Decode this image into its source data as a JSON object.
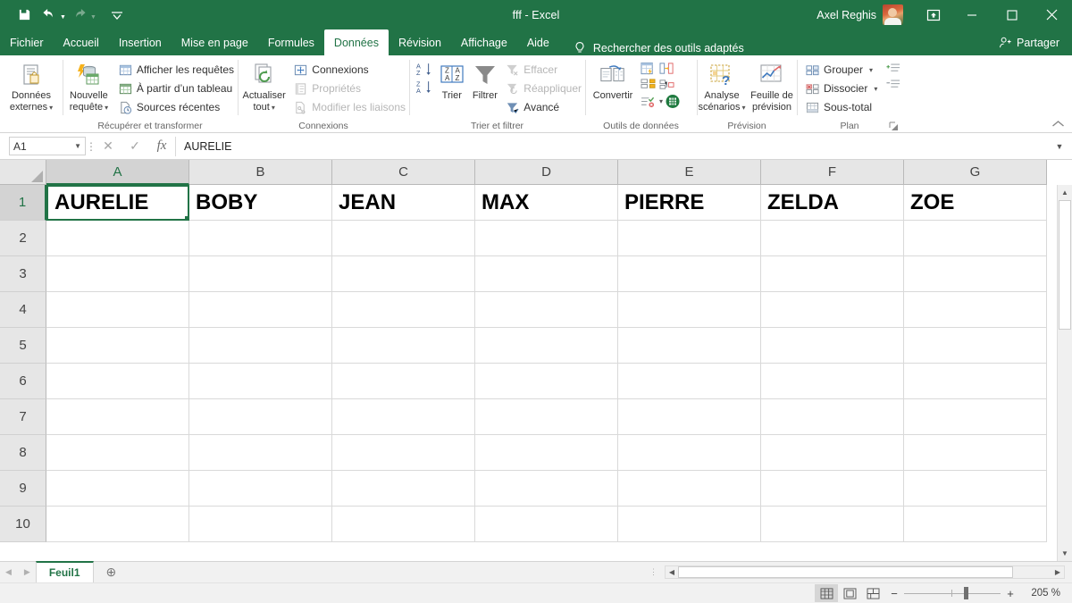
{
  "window": {
    "title": "fff  -  Excel",
    "account_name": "Axel Reghis",
    "quick_access": [
      {
        "name": "save",
        "icon": "save-icon"
      },
      {
        "name": "undo",
        "icon": "undo-icon"
      },
      {
        "name": "redo",
        "icon": "redo-icon"
      },
      {
        "name": "customize-quick-access-toolbar",
        "icon": "chevron-down-icon"
      }
    ],
    "buttons": {
      "ribbon_display_options": "ribbon-display-options-icon",
      "minimize": "minimize-icon",
      "maximize": "maximize-icon",
      "close": "close-icon"
    }
  },
  "tabs": [
    {
      "label": "Fichier",
      "active": false
    },
    {
      "label": "Accueil",
      "active": false
    },
    {
      "label": "Insertion",
      "active": false
    },
    {
      "label": "Mise en page",
      "active": false
    },
    {
      "label": "Formules",
      "active": false
    },
    {
      "label": "Données",
      "active": true
    },
    {
      "label": "Révision",
      "active": false
    },
    {
      "label": "Affichage",
      "active": false
    },
    {
      "label": "Aide",
      "active": false
    }
  ],
  "tellme": {
    "placeholder": "Rechercher des outils adaptés",
    "icon": "lightbulb-icon"
  },
  "share": {
    "label": "Partager",
    "icon": "share-person-icon"
  },
  "ribbon": {
    "groups": [
      {
        "label": "",
        "big_buttons": [
          {
            "label_line1": "Données",
            "label_line2": "externes",
            "has_caret": true,
            "icon": "external-data-icon"
          }
        ],
        "small_items": []
      },
      {
        "label": "Récupérer et transformer",
        "big_buttons": [
          {
            "label_line1": "Nouvelle",
            "label_line2": "requête",
            "has_caret": true,
            "icon": "new-query-icon"
          }
        ],
        "small_items": [
          {
            "label": "Afficher les requêtes",
            "icon": "show-queries-icon",
            "disabled": false
          },
          {
            "label": "À partir d’un tableau",
            "icon": "from-table-icon",
            "disabled": false
          },
          {
            "label": "Sources récentes",
            "icon": "recent-sources-icon",
            "disabled": false
          }
        ]
      },
      {
        "label": "Connexions",
        "big_buttons": [
          {
            "label_line1": "Actualiser",
            "label_line2": "tout",
            "has_caret": true,
            "icon": "refresh-all-icon"
          }
        ],
        "small_items": [
          {
            "label": "Connexions",
            "icon": "connections-icon",
            "disabled": false
          },
          {
            "label": "Propriétés",
            "icon": "properties-icon",
            "disabled": true
          },
          {
            "label": "Modifier les liaisons",
            "icon": "edit-links-icon",
            "disabled": true
          }
        ]
      },
      {
        "label": "Trier et filtrer",
        "big_buttons": [
          {
            "label_line1": "Trier",
            "label_line2": "",
            "has_caret": false,
            "icon": "sort-icon"
          },
          {
            "label_line1": "Filtrer",
            "label_line2": "",
            "has_caret": false,
            "icon": "filter-icon"
          }
        ],
        "mini_sort": [
          {
            "name": "sort-ascending-icon",
            "label": "A→Z"
          },
          {
            "name": "sort-descending-icon",
            "label": "Z→A"
          }
        ],
        "small_items": [
          {
            "label": "Effacer",
            "icon": "clear-filter-icon",
            "disabled": true
          },
          {
            "label": "Réappliquer",
            "icon": "reapply-icon",
            "disabled": true
          },
          {
            "label": "Avancé",
            "icon": "advanced-filter-icon",
            "disabled": false
          }
        ]
      },
      {
        "label": "Outils de données",
        "big_buttons": [
          {
            "label_line1": "Convertir",
            "label_line2": "",
            "has_caret": false,
            "icon": "text-to-columns-icon"
          }
        ],
        "small_items": [
          {
            "label": "",
            "icon": "flash-fill-icon",
            "disabled": false
          },
          {
            "label": "",
            "icon": "remove-duplicates-icon",
            "disabled": false
          },
          {
            "label": "",
            "icon": "data-validation-icon",
            "disabled": false
          },
          {
            "label": "",
            "icon": "consolidate-icon",
            "disabled": false
          },
          {
            "label": "",
            "icon": "relationships-icon",
            "disabled": false
          },
          {
            "label": "",
            "icon": "manage-data-model-icon",
            "disabled": false
          }
        ]
      },
      {
        "label": "Prévision",
        "big_buttons": [
          {
            "label_line1": "Analyse",
            "label_line2": "scénarios",
            "has_caret": true,
            "icon": "what-if-analysis-icon"
          },
          {
            "label_line1": "Feuille de",
            "label_line2": "prévision",
            "has_caret": false,
            "icon": "forecast-sheet-icon"
          }
        ],
        "small_items": []
      },
      {
        "label": "Plan",
        "big_buttons": [],
        "small_items": [
          {
            "label": "Grouper",
            "icon": "group-icon",
            "disabled": false,
            "has_caret": true
          },
          {
            "label": "Dissocier",
            "icon": "ungroup-icon",
            "disabled": false,
            "has_caret": true
          },
          {
            "label": "Sous-total",
            "icon": "subtotal-icon",
            "disabled": false,
            "has_caret": false
          }
        ],
        "right_items": [
          {
            "label": "",
            "icon": "show-detail-icon"
          },
          {
            "label": "",
            "icon": "hide-detail-icon"
          }
        ],
        "has_dialog_launcher": true
      }
    ],
    "collapse_icon": "collapse-ribbon-icon"
  },
  "formula_bar": {
    "name_box_value": "A1",
    "name_box_caret": "chevron-down-icon",
    "cancel_icon": "cancel-icon",
    "confirm_icon": "confirm-icon",
    "function_icon": "insert-function-icon",
    "formula_value": "AURELIE",
    "expand_icon": "expand-formula-bar-icon"
  },
  "grid": {
    "columns": [
      "A",
      "B",
      "C",
      "D",
      "E",
      "F",
      "G"
    ],
    "selected_column": "A",
    "rows": [
      "1",
      "2",
      "3",
      "4",
      "5",
      "6",
      "7",
      "8",
      "9",
      "10"
    ],
    "selected_row": "1",
    "active_cell": "A1",
    "data": [
      [
        "AURELIE",
        "BOBY",
        "JEAN",
        "MAX",
        "PIERRE",
        "ZELDA",
        "ZOE"
      ],
      [
        "",
        "",
        "",
        "",
        "",
        "",
        ""
      ],
      [
        "",
        "",
        "",
        "",
        "",
        "",
        ""
      ],
      [
        "",
        "",
        "",
        "",
        "",
        "",
        ""
      ],
      [
        "",
        "",
        "",
        "",
        "",
        "",
        ""
      ],
      [
        "",
        "",
        "",
        "",
        "",
        "",
        ""
      ],
      [
        "",
        "",
        "",
        "",
        "",
        "",
        ""
      ],
      [
        "",
        "",
        "",
        "",
        "",
        "",
        ""
      ],
      [
        "",
        "",
        "",
        "",
        "",
        "",
        ""
      ],
      [
        "",
        "",
        "",
        "",
        "",
        "",
        ""
      ]
    ]
  },
  "sheet_bar": {
    "nav_first": "nav-previous-icon",
    "nav_last": "nav-next-icon",
    "sheets": [
      {
        "label": "Feuil1",
        "active": true
      }
    ],
    "add_sheet_icon": "add-sheet-icon"
  },
  "status_bar": {
    "views": [
      {
        "name": "normal-view",
        "icon": "normal-view-icon",
        "active": true
      },
      {
        "name": "page-layout-view",
        "icon": "page-layout-icon",
        "active": false
      },
      {
        "name": "page-break-view",
        "icon": "page-break-icon",
        "active": false
      }
    ],
    "zoom_out": "−",
    "zoom_in": "+",
    "zoom_value": "205 %"
  },
  "colors": {
    "brand_green": "#217346",
    "ribbon_bg": "#ffffff",
    "header_gray": "#e6e6e6",
    "selected_header_gray": "#d3d3d3"
  }
}
